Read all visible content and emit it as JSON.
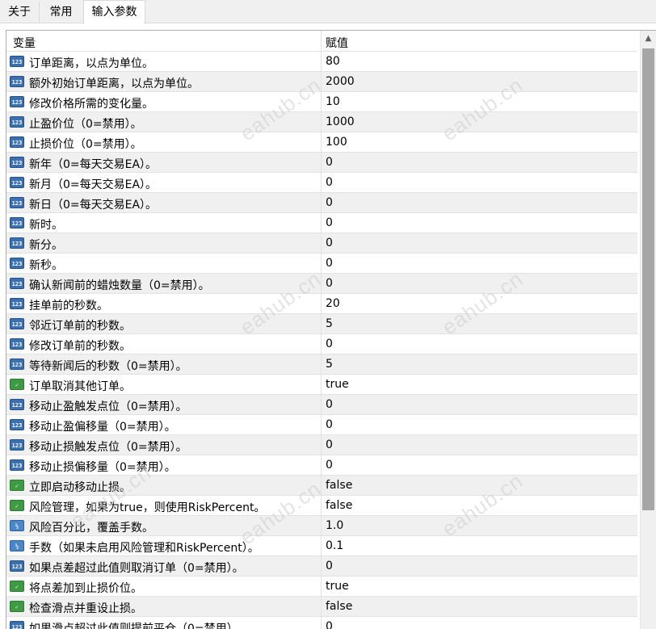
{
  "tabs": [
    "关于",
    "常用",
    "输入参数"
  ],
  "active_tab": "输入参数",
  "table": {
    "headers": {
      "name": "变量",
      "value": "赋值"
    },
    "rows": [
      {
        "icon": "int",
        "name": "订单距离，以点为单位。",
        "value": "80"
      },
      {
        "icon": "int",
        "name": "额外初始订单距离，以点为单位。",
        "value": "2000"
      },
      {
        "icon": "int",
        "name": "修改价格所需的变化量。",
        "value": "10"
      },
      {
        "icon": "int",
        "name": "止盈价位（0=禁用）。",
        "value": "1000"
      },
      {
        "icon": "int",
        "name": "止损价位（0=禁用）。",
        "value": "100"
      },
      {
        "icon": "int",
        "name": "新年（0=每天交易EA）。",
        "value": "0"
      },
      {
        "icon": "int",
        "name": "新月（0=每天交易EA）。",
        "value": "0"
      },
      {
        "icon": "int",
        "name": "新日（0=每天交易EA）。",
        "value": "0"
      },
      {
        "icon": "int",
        "name": "新时。",
        "value": "0"
      },
      {
        "icon": "int",
        "name": "新分。",
        "value": "0"
      },
      {
        "icon": "int",
        "name": "新秒。",
        "value": "0"
      },
      {
        "icon": "int",
        "name": "确认新闻前的蜡烛数量（0=禁用）。",
        "value": "0"
      },
      {
        "icon": "int",
        "name": "挂单前的秒数。",
        "value": "20"
      },
      {
        "icon": "int",
        "name": "邻近订单前的秒数。",
        "value": "5"
      },
      {
        "icon": "int",
        "name": "修改订单前的秒数。",
        "value": "0"
      },
      {
        "icon": "int",
        "name": "等待新闻后的秒数（0=禁用）。",
        "value": "5"
      },
      {
        "icon": "bool",
        "name": "订单取消其他订单。",
        "value": "true"
      },
      {
        "icon": "int",
        "name": "移动止盈触发点位（0=禁用）。",
        "value": "0"
      },
      {
        "icon": "int",
        "name": "移动止盈偏移量（0=禁用）。",
        "value": "0"
      },
      {
        "icon": "int",
        "name": "移动止损触发点位（0=禁用）。",
        "value": "0"
      },
      {
        "icon": "int",
        "name": "移动止损偏移量（0=禁用）。",
        "value": "0"
      },
      {
        "icon": "bool",
        "name": "立即启动移动止损。",
        "value": "false"
      },
      {
        "icon": "bool",
        "name": "风险管理，如果为true，则使用RiskPercent。",
        "value": "false"
      },
      {
        "icon": "double",
        "name": "风险百分比，覆盖手数。",
        "value": "1.0"
      },
      {
        "icon": "double",
        "name": "手数（如果未启用风险管理和RiskPercent）。",
        "value": "0.1"
      },
      {
        "icon": "int",
        "name": "如果点差超过此值则取消订单（0=禁用）。",
        "value": "0"
      },
      {
        "icon": "bool",
        "name": "将点差加到止损价位。",
        "value": "true"
      },
      {
        "icon": "bool",
        "name": "检查滑点并重设止损。",
        "value": "false"
      },
      {
        "icon": "int",
        "name": "如果滑点超过此值则提前平仓（0=禁用）。",
        "value": "0"
      }
    ]
  },
  "icons": {
    "int": "123",
    "bool": "✓",
    "double": "½"
  },
  "watermark_text": "eahub.cn",
  "colors": {
    "int_icon": "#3a6fb0",
    "bool_icon": "#3f9a44",
    "row_alt": "#f0f0f0",
    "scroll_thumb": "#a6a6a6"
  }
}
